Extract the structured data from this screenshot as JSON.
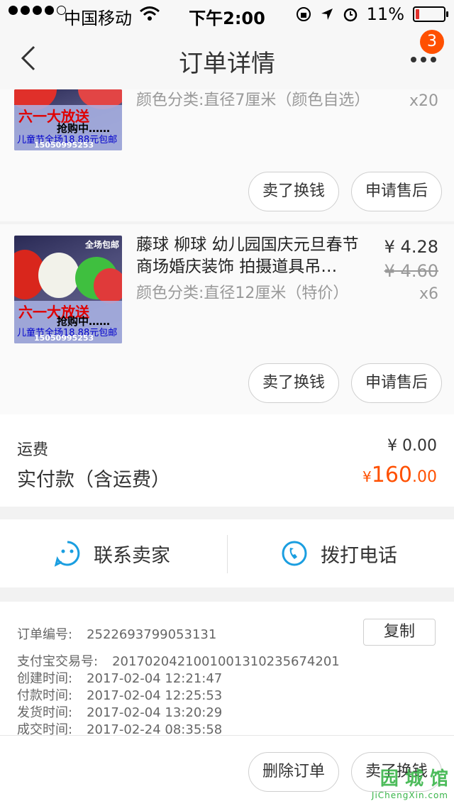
{
  "status_bar": {
    "carrier": "中国移动",
    "time": "下午2:00",
    "battery": "11%"
  },
  "nav": {
    "title": "订单详情",
    "badge": "3"
  },
  "items": [
    {
      "sku": "颜色分类:直径7厘米（颜色自选）",
      "qty": "x20",
      "promo_top": "六一大放送",
      "promo_mid": "抢购中……",
      "promo_bottom": "儿童节全场18.88元包邮",
      "promo_phone": "15050995253",
      "btn_resell": "卖了换钱",
      "btn_aftersale": "申请售后"
    },
    {
      "title": "藤球 柳球 幼儿园国庆元旦春节商场婚庆装饰 拍摄道具吊…",
      "price": "¥ 4.28",
      "old_price": "¥ 4.60",
      "sku": "颜色分类:直径12厘米（特价）",
      "qty": "x6",
      "free_tag": "全场包邮",
      "promo_top": "六一大放送",
      "promo_mid": "抢购中……",
      "promo_bottom": "儿童节全场18.88元包邮",
      "promo_phone": "15050995253",
      "btn_resell": "卖了换钱",
      "btn_aftersale": "申请售后"
    }
  ],
  "summary": {
    "shipping_label": "运费",
    "shipping_value": "¥ 0.00",
    "total_label": "实付款（含运费）",
    "total_currency": "¥",
    "total_int": "160",
    "total_dec": ".00"
  },
  "contact": {
    "seller_label": "联系卖家",
    "phone_label": "拨打电话"
  },
  "order_info": {
    "order_no_label": "订单编号:",
    "order_no": "2522693799053131",
    "copy_label": "复制",
    "alipay_label": "支付宝交易号:",
    "alipay_no": "2017020421001001310235674201",
    "created_label": "创建时间:",
    "created": "2017-02-04 12:21:47",
    "paid_label": "付款时间:",
    "paid": "2017-02-04 12:25:53",
    "shipped_label": "发货时间:",
    "shipped": "2017-02-04 13:20:29",
    "closed_label": "成交时间:",
    "closed": "2017-02-24 08:35:58"
  },
  "bottom_actions": {
    "delete_label": "删除订单",
    "resell_label": "卖了换钱"
  },
  "watermark": {
    "main": "园 城 馆",
    "sub": "JiChengXin.com"
  },
  "colors": {
    "accent": "#ff5000",
    "contact_icon": "#1a9ee0"
  }
}
